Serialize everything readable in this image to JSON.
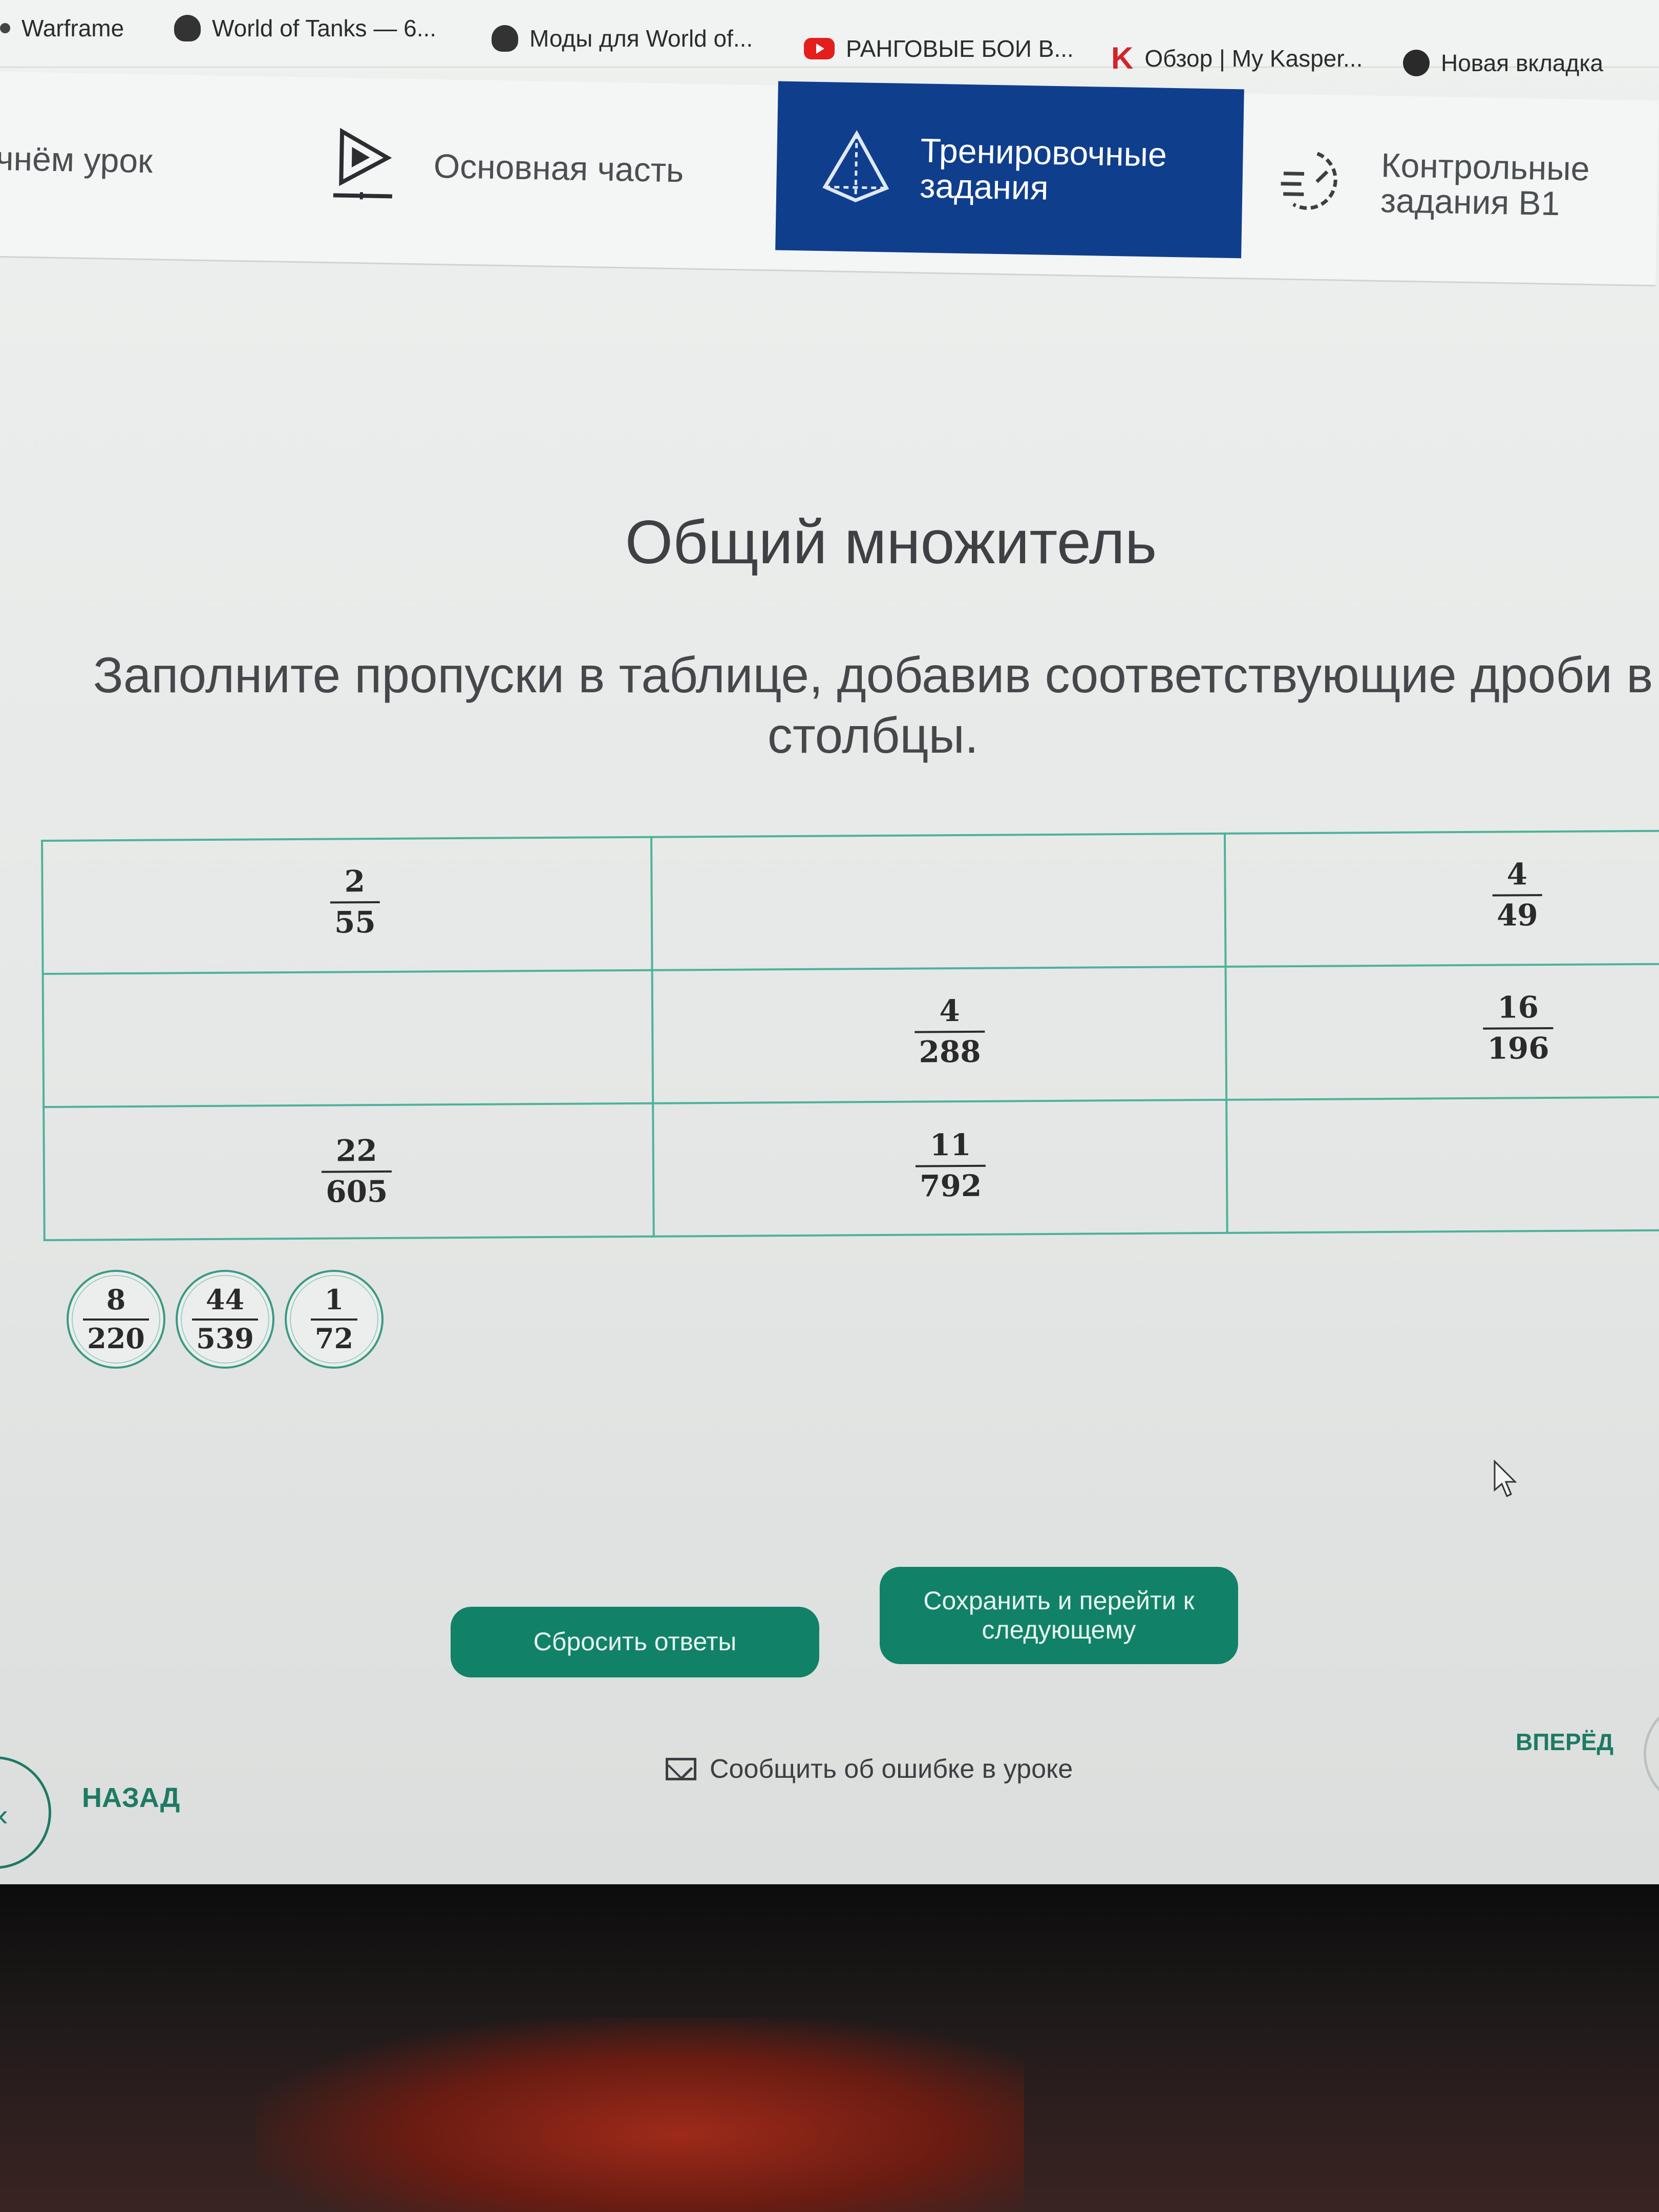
{
  "bookmarks": [
    {
      "label": "Warframe",
      "icon": "warframe-icon"
    },
    {
      "label": "World of Tanks — 6...",
      "icon": "tank-icon"
    },
    {
      "label": "Моды для World of...",
      "icon": "tank-icon"
    },
    {
      "label": "РАНГОВЫЕ БОИ В...",
      "icon": "youtube-icon"
    },
    {
      "label": "Обзор | My Kasper...",
      "icon": "kaspersky-icon"
    },
    {
      "label": "Новая вкладка",
      "icon": "globe-icon"
    }
  ],
  "lesson_nav": {
    "start": "ачнём урок",
    "main": "Основная часть",
    "training_line1": "Тренировочные",
    "training_line2": "задания",
    "control_line1": "Контрольные",
    "control_line2": "задания B1",
    "active": "training"
  },
  "task": {
    "title": "Общий множитель",
    "instruction": "Заполните пропуски в таблице, добавив соответствующие дроби в столбцы."
  },
  "table": {
    "rows": [
      [
        {
          "num": "2",
          "den": "55"
        },
        null,
        {
          "num": "4",
          "den": "49"
        }
      ],
      [
        null,
        {
          "num": "4",
          "den": "288"
        },
        {
          "num": "16",
          "den": "196"
        }
      ],
      [
        {
          "num": "22",
          "den": "605"
        },
        {
          "num": "11",
          "den": "792"
        },
        null
      ]
    ]
  },
  "choices": [
    {
      "num": "8",
      "den": "220"
    },
    {
      "num": "44",
      "den": "539"
    },
    {
      "num": "1",
      "den": "72"
    }
  ],
  "buttons": {
    "reset": "Сбросить ответы",
    "save": "Сохранить и перейти к следующему"
  },
  "footer": {
    "report": "Сообщить об ошибке в уроке",
    "back": "НАЗАД",
    "forward": "ВПЕРЁД"
  },
  "colors": {
    "accent_green": "#118268",
    "table_border": "#4db39a",
    "active_tab": "#0f3e8d"
  }
}
